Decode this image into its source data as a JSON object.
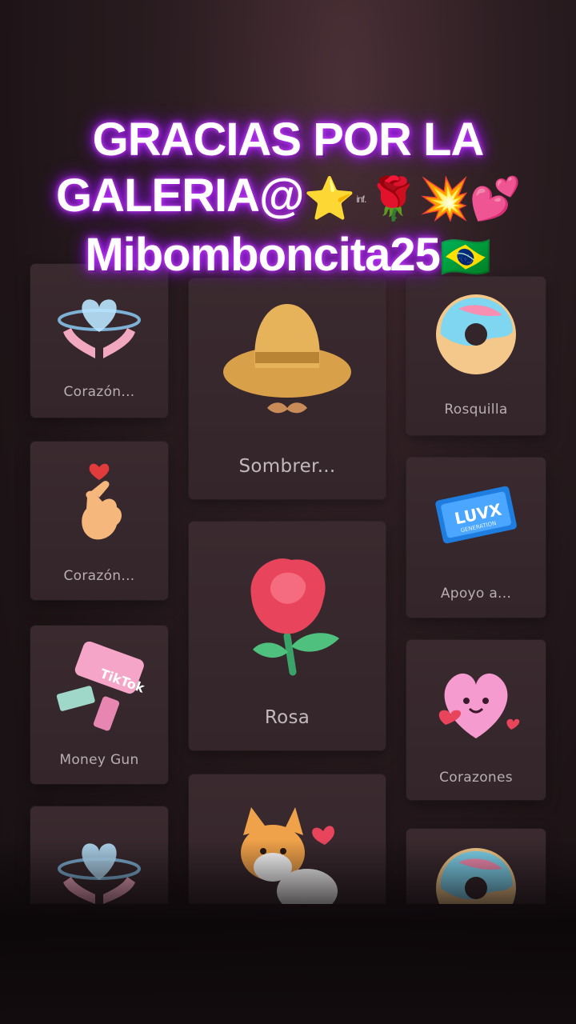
{
  "overlay": {
    "line1": "GRACIAS POR LA",
    "line2_text": "GALERIA@",
    "line2_small": "inf.",
    "line3_text": "Mibomboncita25",
    "emoji": {
      "star": "⭐",
      "rose": "🌹",
      "collision": "💥",
      "hearts": "💕",
      "flag": "🇧🇷"
    }
  },
  "gifts": {
    "left": [
      {
        "label": "Corazón...",
        "icon": "heart-hands-icon"
      },
      {
        "label": "Corazón...",
        "icon": "finger-heart-icon"
      },
      {
        "label": "Money Gun",
        "icon": "money-gun-icon"
      },
      {
        "label": "",
        "icon": "heart-hands-icon"
      }
    ],
    "center": [
      {
        "label": "Sombrer...",
        "icon": "cowboy-hat-icon"
      },
      {
        "label": "Rosa",
        "icon": "rose-icon"
      },
      {
        "label": "",
        "icon": "corgi-icon"
      }
    ],
    "right": [
      {
        "label": "Rosquilla",
        "icon": "donut-icon"
      },
      {
        "label": "Apoyo a...",
        "icon": "ticket-icon"
      },
      {
        "label": "Corazones",
        "icon": "hearts-icon"
      },
      {
        "label": "",
        "icon": "donut-icon"
      }
    ]
  },
  "art_text": {
    "money_gun_brand": "TikTok",
    "ticket_brand": "LUVX",
    "ticket_sub": "GENERATION"
  },
  "colors": {
    "glow": "#b026ff",
    "card": "#3a2a2f",
    "label": "#b9aeb0"
  }
}
